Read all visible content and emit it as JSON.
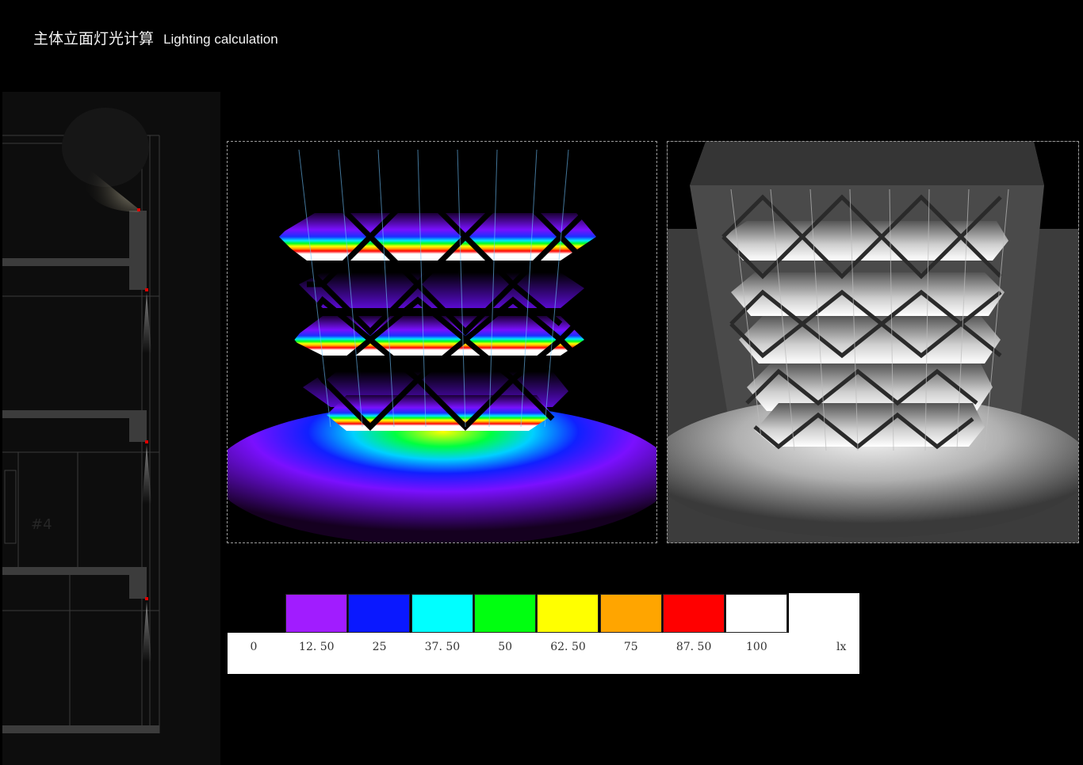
{
  "page": {
    "title_cn": "主体立面灯光计算",
    "title_en": "Lighting calculation"
  },
  "legend": {
    "colors": [
      "#a11cff",
      "#0a18ff",
      "#00ffff",
      "#00ff10",
      "#ffff00",
      "#ffa500",
      "#ff0000",
      "#ffffff"
    ],
    "ticks": [
      "0",
      "12. 50",
      "25",
      "37. 50",
      "50",
      "62. 50",
      "75",
      "87. 50",
      "100"
    ],
    "unit": "lx"
  },
  "images": {
    "pseudo_color_render": "false-color illuminance render of facade",
    "grayscale_render": "grayscale luminance render of facade",
    "section_drawing": "facade section with downlights"
  },
  "accent_colors": {
    "fixture_red": "#e00000",
    "frame_dash": "#9a9a9a"
  }
}
